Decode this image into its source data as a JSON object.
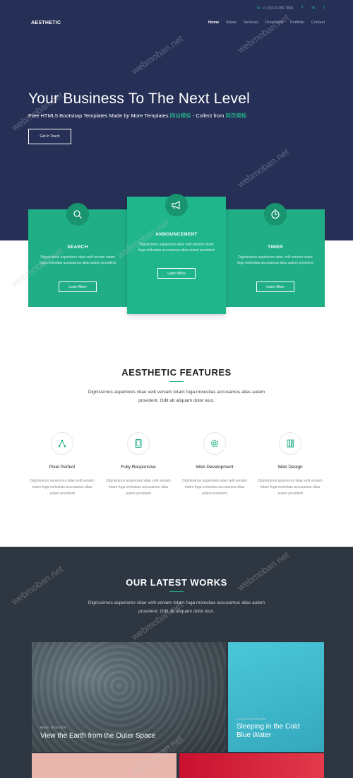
{
  "topbar": {
    "phone": "+1 (0)123 456 7890",
    "icons": [
      "phone-icon",
      "twitter-icon",
      "email-icon",
      "facebook-icon"
    ]
  },
  "nav": {
    "logo": "AESTHETIC",
    "items": [
      "Home",
      "About",
      "Services",
      "Dropdown",
      "Portfolio",
      "Contact"
    ],
    "active": "Home"
  },
  "hero": {
    "title": "Your Business To The Next Level",
    "sub_part1": "Free HTML5 Bootstrap Templates Made ",
    "sub_by": "by",
    "sub_part2": " More Templates ",
    "sub_link1": "网站模板",
    "sub_part3": " - Collect from ",
    "sub_link2": "网页模板",
    "cta": "Get In Touch",
    "colors": {
      "bg": "#262f56",
      "accent": "#23d19a"
    }
  },
  "cards": [
    {
      "icon": "search-icon",
      "title": "SEARCH",
      "body": "Dignissimos asperiores vitae velit veniam totam fuga molestias accusamus alias autem provident",
      "button": "Learn More"
    },
    {
      "icon": "megaphone-icon",
      "title": "ANNOUNCEMENT",
      "body": "Dignissimos asperiores vitae velit veniam totam fuga molestias accusamus alias autem provident",
      "button": "Learn More"
    },
    {
      "icon": "clock-icon",
      "title": "TIMER",
      "body": "Dignissimos asperiores vitae velit veniam totam fuga molestias accusamus alias autem provident",
      "button": "Learn More"
    }
  ],
  "features": {
    "title": "AESTHETIC FEATURES",
    "desc": "Dignissimos asperiores vitae velit veniam totam fuga molestias accusamus alias autem provident. Odit ab aliquam dolor eius.",
    "items": [
      {
        "icon": "vector-pen-icon",
        "name": "Pixel Perfect",
        "desc": "Dignissimos asperiores vitae velit veniam totam fuga molestias accusamus alias autem provident"
      },
      {
        "icon": "tablet-icon",
        "name": "Fully Responsive",
        "desc": "Dignissimos asperiores vitae velit veniam totam fuga molestias accusamus alias autem provident"
      },
      {
        "icon": "gear-icon",
        "name": "Web Development",
        "desc": "Dignissimos asperiores vitae velit veniam totam fuga molestias accusamus alias autem provident"
      },
      {
        "icon": "palette-icon",
        "name": "Web Design",
        "desc": "Dignissimos asperiores vitae velit veniam totam fuga molestias accusamus alias autem provident"
      }
    ]
  },
  "works": {
    "title": "OUR LATEST WORKS",
    "desc": "Dignissimos asperiores vitae velit veniam totam fuga molestias accusamus alias autem provident. Odit ab aliquam dolor eius.",
    "tiles": [
      {
        "category": "WEB DESIGN",
        "title": "View the Earth from the Outer Space"
      },
      {
        "category": "ILLUSTRATION",
        "title": "Sleeping in the Cold Blue Water"
      }
    ]
  },
  "watermark": "webmoban.net"
}
